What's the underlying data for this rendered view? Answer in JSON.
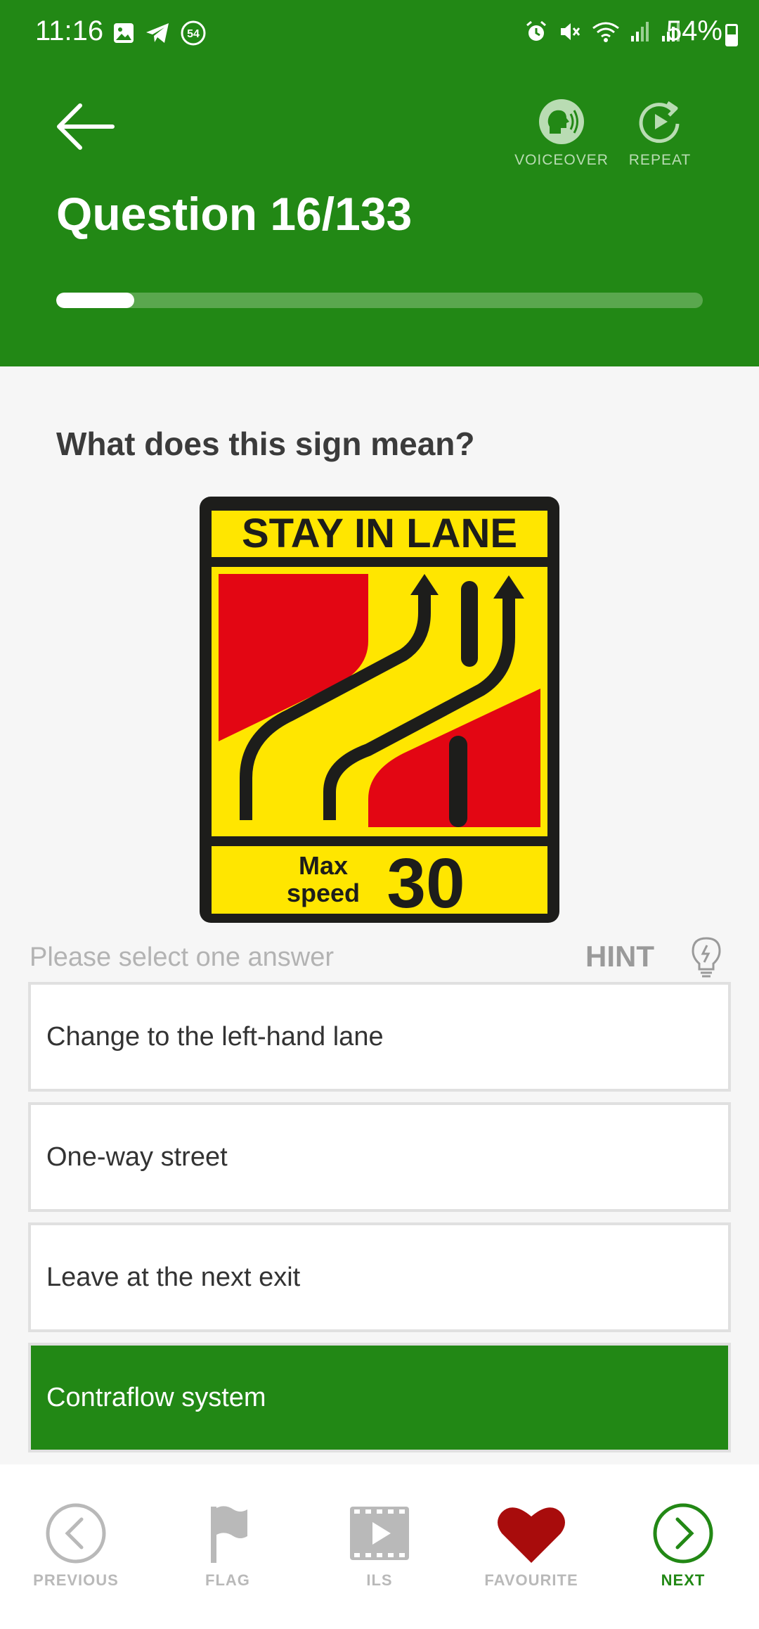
{
  "status": {
    "time": "11:16",
    "battery": "54%",
    "notification_badge": "54"
  },
  "header": {
    "title": "Question 16/133",
    "voiceover_label": "VOICEOVER",
    "repeat_label": "REPEAT",
    "progress_fraction": 0.1203
  },
  "question": {
    "text": "What does this sign mean?",
    "sign": {
      "top_text": "STAY IN LANE",
      "max_label_1": "Max",
      "max_label_2": "speed",
      "speed": "30"
    }
  },
  "answers": {
    "prompt": "Please select one answer",
    "hint_label": "HINT",
    "options": [
      {
        "label": "Change to the left-hand lane",
        "selected": false
      },
      {
        "label": "One-way street",
        "selected": false
      },
      {
        "label": "Leave at the next exit",
        "selected": false
      },
      {
        "label": "Contraflow system",
        "selected": true
      }
    ]
  },
  "nav": {
    "previous": "PREVIOUS",
    "flag": "FLAG",
    "ils": "ILS",
    "favourite": "FAVOURITE",
    "next": "NEXT"
  },
  "colors": {
    "brand_green": "#228815",
    "heart_red": "#a80c0c",
    "sign_yellow": "#ffe600",
    "sign_red": "#e30613"
  }
}
